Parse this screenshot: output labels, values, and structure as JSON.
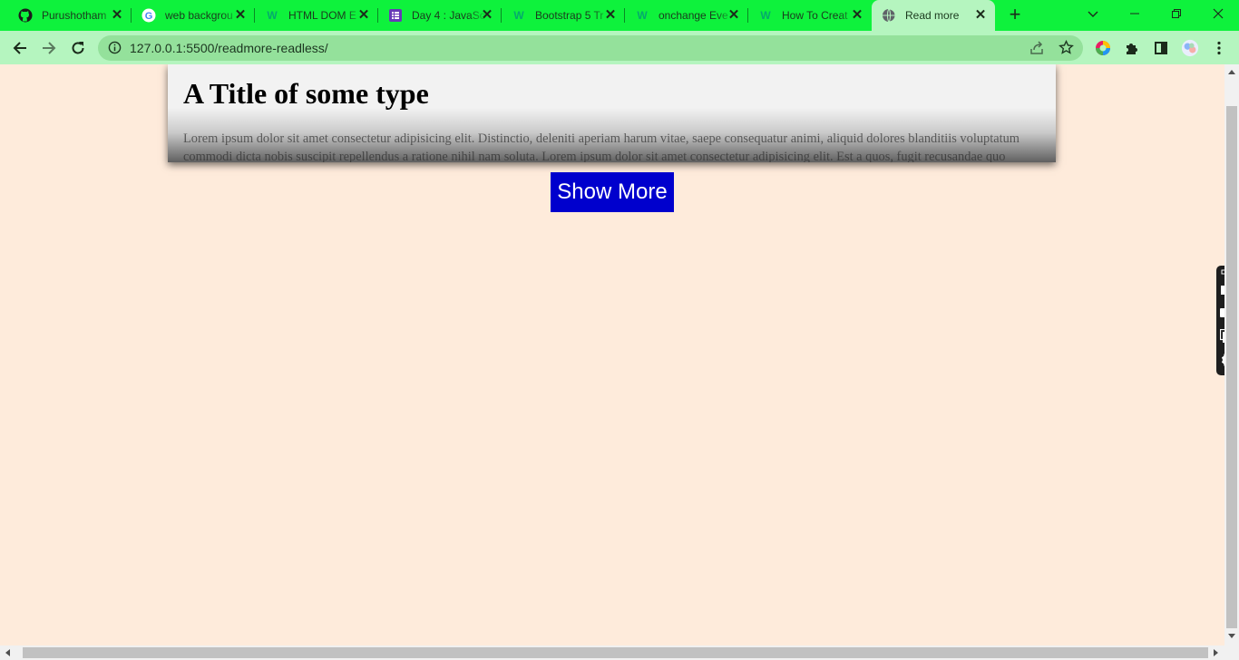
{
  "browser": {
    "tabs": [
      {
        "title": "Purushotham",
        "icon": "github-icon"
      },
      {
        "title": "web backgrou",
        "icon": "google-icon"
      },
      {
        "title": "HTML DOM E",
        "icon": "w3schools-icon"
      },
      {
        "title": "Day 4 : JavaSc",
        "icon": "form-icon"
      },
      {
        "title": "Bootstrap 5 Tr",
        "icon": "w3schools-icon"
      },
      {
        "title": "onchange Eve",
        "icon": "w3schools-icon"
      },
      {
        "title": "How To Creat",
        "icon": "w3schools-icon"
      },
      {
        "title": "Read more",
        "icon": "globe-icon",
        "active": true
      }
    ],
    "url": "127.0.0.1:5500/readmore-readless/",
    "colors": {
      "tab_strip": "#0ef23c",
      "toolbar": "#b5f5bf",
      "omnibox": "#94e19b"
    }
  },
  "page": {
    "title": "A Title of some type",
    "body": "Lorem ipsum dolor sit amet consectetur adipisicing elit. Distinctio, deleniti aperiam harum vitae, saepe consequatur animi, aliquid dolores blanditiis voluptatum commodi dicta nobis suscipit repellendus a ratione nihil nam soluta. Lorem ipsum dolor sit amet consectetur adipisicing elit. Est a quos, fugit recusandae quo",
    "button_label": "Show More",
    "colors": {
      "background": "#feebdb",
      "button": "#0000cd",
      "button_text": "#ffffff"
    }
  },
  "widget": {
    "icons": [
      "camera-icon",
      "video-icon",
      "window-icon",
      "gear-icon"
    ]
  }
}
